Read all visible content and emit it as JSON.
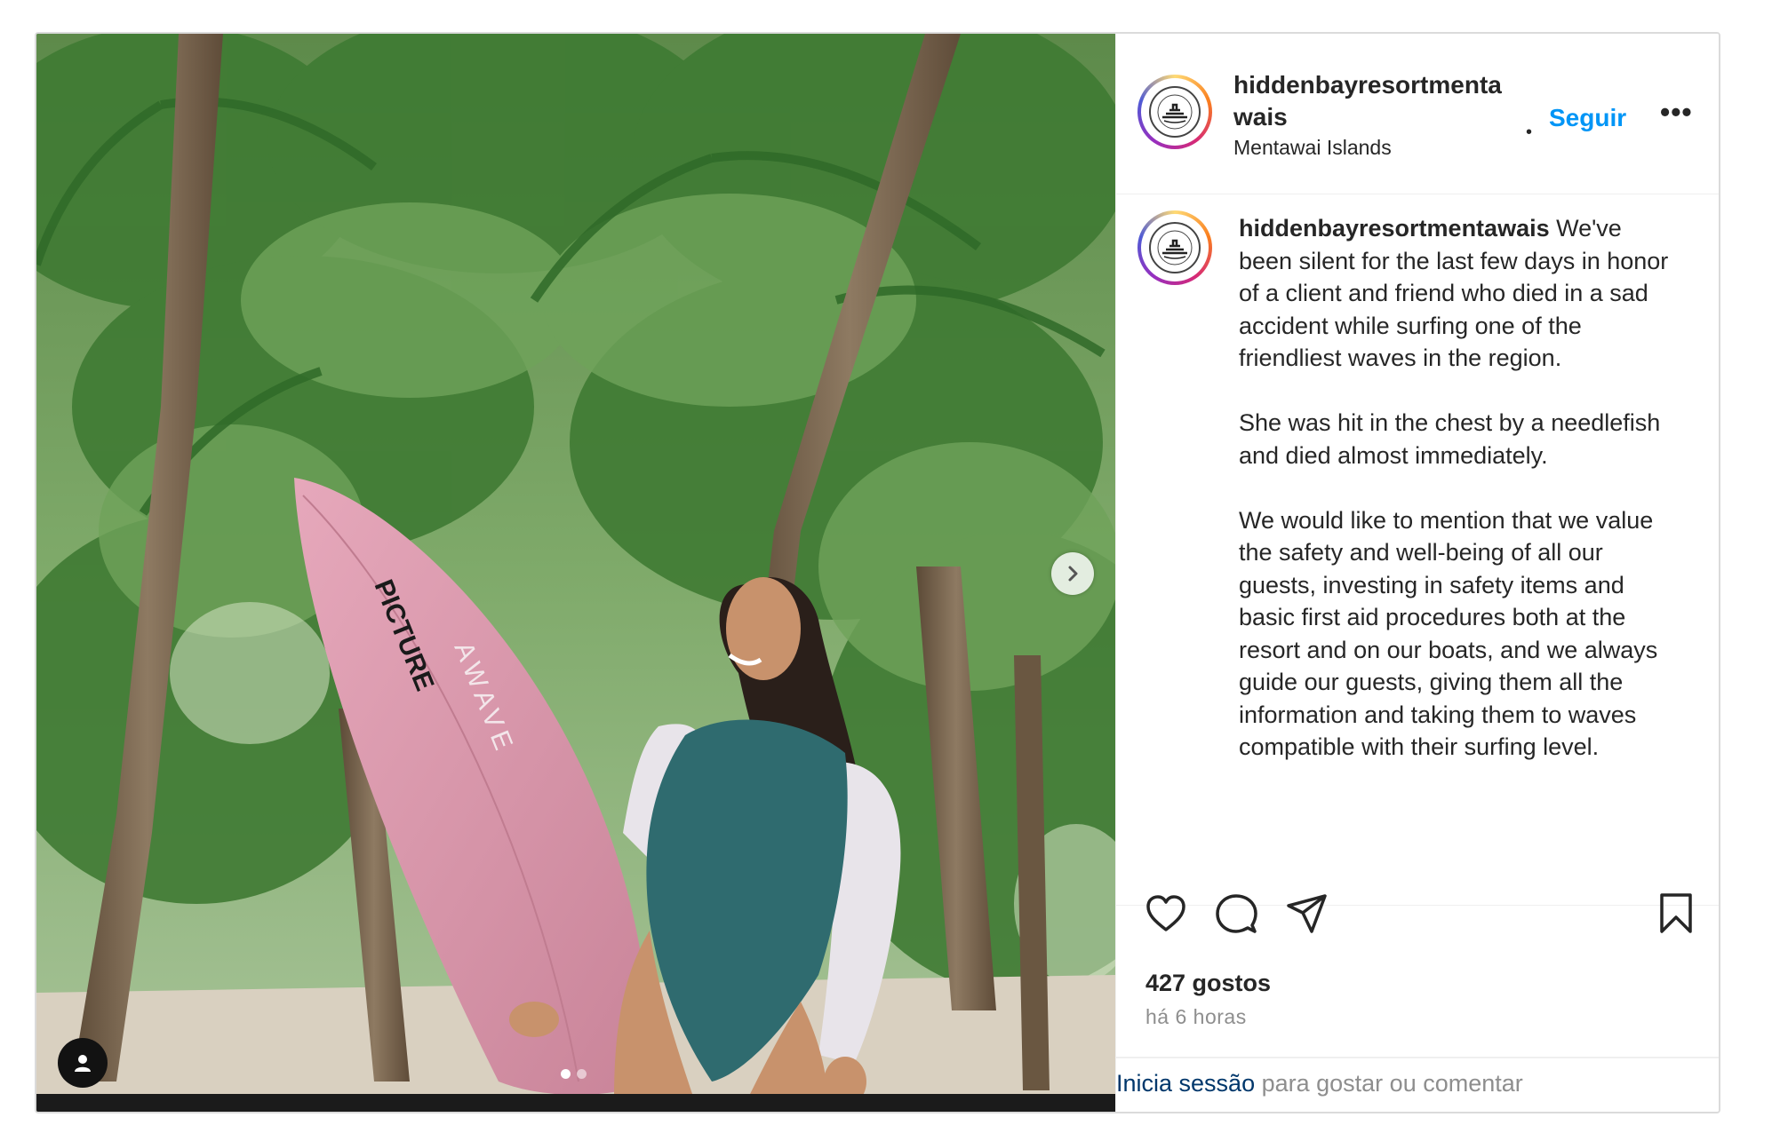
{
  "post": {
    "author": {
      "username_line1": "hiddenbayresortmenta",
      "username_line2": "wais",
      "location": "Mentawai Islands",
      "avatar_icon": "resort-logo-icon"
    },
    "header": {
      "separator": "•",
      "follow_label": "Seguir",
      "more_label": "•••"
    },
    "caption": {
      "username": "hiddenbayresortmentawais",
      "paragraphs": [
        "We've been silent for the last few days in honor of a client and friend who died in a sad accident while surfing one of the friendliest waves in the region.",
        "She was hit in the chest by a needlefish and died almost immediately.",
        "We would like to mention that we value the safety and well-being of all our guests, investing in safety items and basic first aid procedures both at the resort and on our boats, and we always guide our guests, giving them all the information and taking them to waves compatible with their surfing level."
      ]
    },
    "actions": {
      "icons": [
        "heart-icon",
        "comment-icon",
        "share-icon",
        "bookmark-icon"
      ]
    },
    "likes": "427 gostos",
    "time": "há 6 horas",
    "login_prompt": {
      "link": "Inicia sessão",
      "rest": " para gostar ou comentar"
    },
    "carousel": {
      "slide_count": 2,
      "active_index": 0
    },
    "media": {
      "board_brand": "PICTURE",
      "board_text": "AWAVE"
    },
    "colors": {
      "follow_blue": "#0095f6",
      "link_blue": "#00376b",
      "muted_grey": "#8e8e8e",
      "board_pink": "#d99aad",
      "swimsuit_teal": "#2f6b6f"
    }
  }
}
